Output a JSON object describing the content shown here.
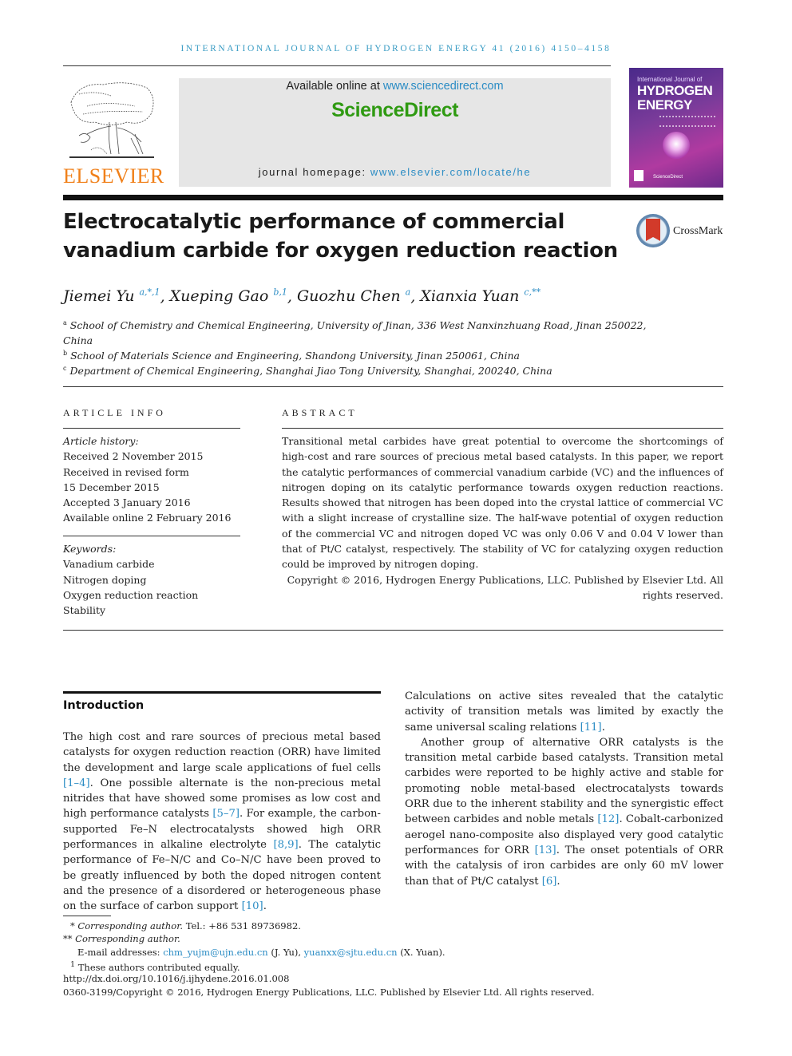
{
  "running_head": "INTERNATIONAL JOURNAL OF HYDROGEN ENERGY 41 (2016) 4150–4158",
  "publisher": {
    "logo_text": "ELSEVIER",
    "logo_color": "#f0801a"
  },
  "sciencedirect": {
    "available_prefix": "Available online at ",
    "available_link": "www.sciencedirect.com",
    "brand": "ScienceDirect",
    "brand_color": "#2f9a12",
    "homepage_prefix": "journal homepage: ",
    "homepage_link": "www.elsevier.com/locate/he"
  },
  "cover": {
    "line1": "International Journal of",
    "line2": "HYDROGEN",
    "line3": "ENERGY",
    "footer": "ScienceDirect"
  },
  "title_line1": "Electrocatalytic performance of commercial",
  "title_line2": "vanadium carbide for oxygen reduction reaction",
  "crossmark": "CrossMark",
  "authors": [
    {
      "name": "Jiemei Yu",
      "sup": "a,*,1",
      "sep": ", "
    },
    {
      "name": "Xueping Gao",
      "sup": "b,1",
      "sep": ", "
    },
    {
      "name": "Guozhu Chen",
      "sup": "a",
      "sep": ", "
    },
    {
      "name": "Xianxia Yuan",
      "sup": "c,**",
      "sep": ""
    }
  ],
  "affiliations": [
    {
      "key": "a",
      "line1": "School of Chemistry and Chemical Engineering, University of Jinan, 336 West Nanxinzhuang Road, Jinan 250022,",
      "line2": "China"
    },
    {
      "key": "b",
      "line1": "School of Materials Science and Engineering, Shandong University, Jinan 250061, China"
    },
    {
      "key": "c",
      "line1": "Department of Chemical Engineering, Shanghai Jiao Tong University, Shanghai, 200240, China"
    }
  ],
  "article_info": {
    "heading": "ARTICLE INFO",
    "history_label": "Article history:",
    "history": [
      "Received 2 November 2015",
      "Received in revised form",
      "15 December 2015",
      "Accepted 3 January 2016",
      "Available online 2 February 2016"
    ],
    "keywords_label": "Keywords:",
    "keywords": [
      "Vanadium carbide",
      "Nitrogen doping",
      "Oxygen reduction reaction",
      "Stability"
    ]
  },
  "abstract": {
    "heading": "ABSTRACT",
    "text": "Transitional metal carbides have great potential to overcome the shortcomings of high-cost and rare sources of precious metal based catalysts. In this paper, we report the catalytic performances of commercial vanadium carbide (VC) and the influences of nitrogen doping on its catalytic performance towards oxygen reduction reactions. Results showed that nitrogen has been doped into the crystal lattice of commercial VC with a slight increase of crystalline size. The half-wave potential of oxygen reduction of the commercial VC and nitrogen doped VC was only 0.06 V and 0.04 V lower than that of Pt/C catalyst, respectively. The stability of VC for catalyzing oxygen reduction could be improved by nitrogen doping.",
    "copyright": "Copyright © 2016, Hydrogen Energy Publications, LLC. Published by Elsevier Ltd. All rights reserved."
  },
  "introduction": {
    "heading": "Introduction",
    "left_paragraph": [
      {
        "t": "The high cost and rare sources of precious metal based catalysts for oxygen reduction reaction (ORR) have limited the development and large scale applications of fuel cells "
      },
      {
        "ref": "[1–4]"
      },
      {
        "t": ". One possible alternate is the non-precious metal nitrides that have showed some promises as low cost and high performance catalysts "
      },
      {
        "ref": "[5–7]"
      },
      {
        "t": ". For example, the carbon-supported Fe–N electrocatalysts showed high ORR performances in alkaline electrolyte "
      },
      {
        "ref": "[8,9]"
      },
      {
        "t": ". The catalytic performance of Fe–N/C and Co–N/C have been proved to be greatly influenced by both the doped nitrogen content and the presence of a disordered or heterogeneous phase on the surface of carbon support "
      },
      {
        "ref": "[10]"
      },
      {
        "t": "."
      }
    ],
    "right_paragraph1": [
      {
        "t": "Calculations on active sites revealed that the catalytic activity of transition metals was limited by exactly the same universal scaling relations "
      },
      {
        "ref": "[11]"
      },
      {
        "t": "."
      }
    ],
    "right_paragraph2": [
      {
        "t": "Another group of alternative ORR catalysts is the transition metal carbide based catalysts. Transition metal carbides were reported to be highly active and stable for promoting noble metal-based electrocatalysts towards ORR due to the inherent stability and the synergistic effect between carbides and noble metals "
      },
      {
        "ref": "[12]"
      },
      {
        "t": ". Cobalt-carbonized aerogel nano-composite also displayed very good catalytic performances for ORR "
      },
      {
        "ref": "[13]"
      },
      {
        "t": ". The onset potentials of ORR with the catalysis of iron carbides are only 60 mV lower than that of Pt/C catalyst "
      },
      {
        "ref": "[6]"
      },
      {
        "t": "."
      }
    ]
  },
  "footnotes": {
    "corr1_mark": "*",
    "corr1_label": "Corresponding author.",
    "corr1_rest": " Tel.: +86 531 89736982.",
    "corr2_mark": "**",
    "corr2_label": "Corresponding author.",
    "email_label": "E-mail addresses: ",
    "email1": "chm_yujm@ujn.edu.cn",
    "email1_who": " (J. Yu), ",
    "email2": "yuanxx@sjtu.edu.cn",
    "email2_who": " (X. Yuan).",
    "equal_mark": "1",
    "equal_text": " These authors contributed equally.",
    "doi": "http://dx.doi.org/10.1016/j.ijhydene.2016.01.008",
    "issn_copyright": "0360-3199/Copyright © 2016, Hydrogen Energy Publications, LLC. Published by Elsevier Ltd. All rights reserved."
  },
  "link_color": "#2b8cc4"
}
